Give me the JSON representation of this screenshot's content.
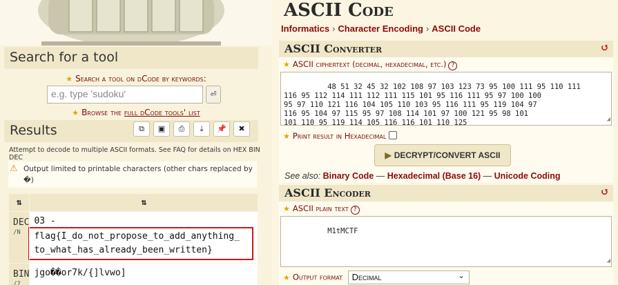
{
  "left": {
    "search_title": "Search for a tool",
    "search_label": "Search a tool on dCode by keywords:",
    "search_placeholder": "e.g. type 'sudoku'",
    "go_icon": "enter-icon",
    "browse_prefix": "Browse the",
    "browse_link": "full dCode tools' list",
    "results_title": "Results",
    "toolbar_icons": [
      "copy-icon",
      "save-icon",
      "print-icon",
      "download-icon",
      "pin-icon",
      "close-icon"
    ],
    "note": "Attempt to decode to multiple ASCII formats. See FAQ for details on HEX BIN DEC",
    "warning": "Output limited to printable characters (other chars replaced by �)",
    "table": {
      "header_left": "⇅",
      "header_right": "⇅",
      "rows": [
        {
          "format": "DEC",
          "sub": "/N",
          "line1": "03 -",
          "line2": "flag{I_do_not_propose_to_add_anything_",
          "line3": "to_what_has_already_been_written}"
        },
        {
          "format": "BIN",
          "sub": "/7",
          "line1": "jgo��or7k/{]lvwo]"
        }
      ]
    }
  },
  "right": {
    "title": "ASCII Code",
    "breadcrumb": [
      "Informatics",
      "Character Encoding",
      "ASCII Code"
    ],
    "converter": {
      "title": "ASCII Converter",
      "ciphertext_label": "ASCII ciphertext (decimal, hexadecimal, etc.)",
      "ciphertext": "48 51 32 45 32 102 108 97 103 123 73 95 100 111 95 110 111\n116 95 112 114 111 112 111 115 101 95 116 111 95 97 100 100\n95 97 110 121 116 104 105 110 103 95 116 111 95 119 104 97\n116 95 104 97 115 95 97 108 114 101 97 100 121 95 98 101\n101 110 95 119 114 105 116 116 101 110 125",
      "hex_option": "Print result in Hexadecimal",
      "button": "DECRYPT/CONVERT ASCII",
      "see_also_label": "See also:",
      "see_also": [
        "Binary Code",
        "Hexadecimal (Base 16)",
        "Unicode Coding"
      ]
    },
    "encoder": {
      "title": "ASCII Encoder",
      "plain_label": "ASCII plain text",
      "plain_text": "M1tMCTF",
      "format_label": "Output format",
      "format_value": "Decimal"
    }
  },
  "colors": {
    "accent_red": "#8a0a0a",
    "panel_bg": "#efe7c8",
    "highlight_box": "#d0151a"
  }
}
